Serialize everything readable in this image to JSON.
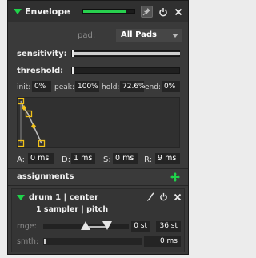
{
  "header": {
    "title": "Envelope",
    "meter_level": 0.85,
    "collapse_icon": "triangle-down-icon",
    "pin_icon": "pin-icon",
    "power_icon": "power-icon",
    "close_icon": "close-icon"
  },
  "pad": {
    "label": "pad:",
    "value": "All Pads"
  },
  "sensitivity": {
    "label": "sensitivity:",
    "value": 1.0
  },
  "threshold": {
    "label": "threshold:",
    "value": 0.0
  },
  "params": {
    "init_label": "init:",
    "init_value": "0%",
    "peak_label": "peak:",
    "peak_value": "100%",
    "hold_label": "hold:",
    "hold_value": "72.6%",
    "end_label": "end:",
    "end_value": "0%"
  },
  "adsr": {
    "attack_label": "A:",
    "attack_value": "0 ms",
    "decay_label": "D:",
    "decay_value": "1 ms",
    "sustain_label": "S:",
    "sustain_value": "0 ms",
    "release_label": "R:",
    "release_value": "9 ms"
  },
  "assignments": {
    "title": "assignments",
    "add_icon": "move-add-icon",
    "items": [
      {
        "name": "drum 1 | center",
        "subtitle": "1 sampler | pitch",
        "range_label": "rnge:",
        "range_min": "0 st",
        "range_max": "36 st",
        "smooth_label": "smth:",
        "smooth_value": "0 ms"
      }
    ]
  },
  "colors": {
    "accent_green": "#1fd34a",
    "envelope_handle": "#f2c21a",
    "panel_bg": "#3a3a3a"
  }
}
